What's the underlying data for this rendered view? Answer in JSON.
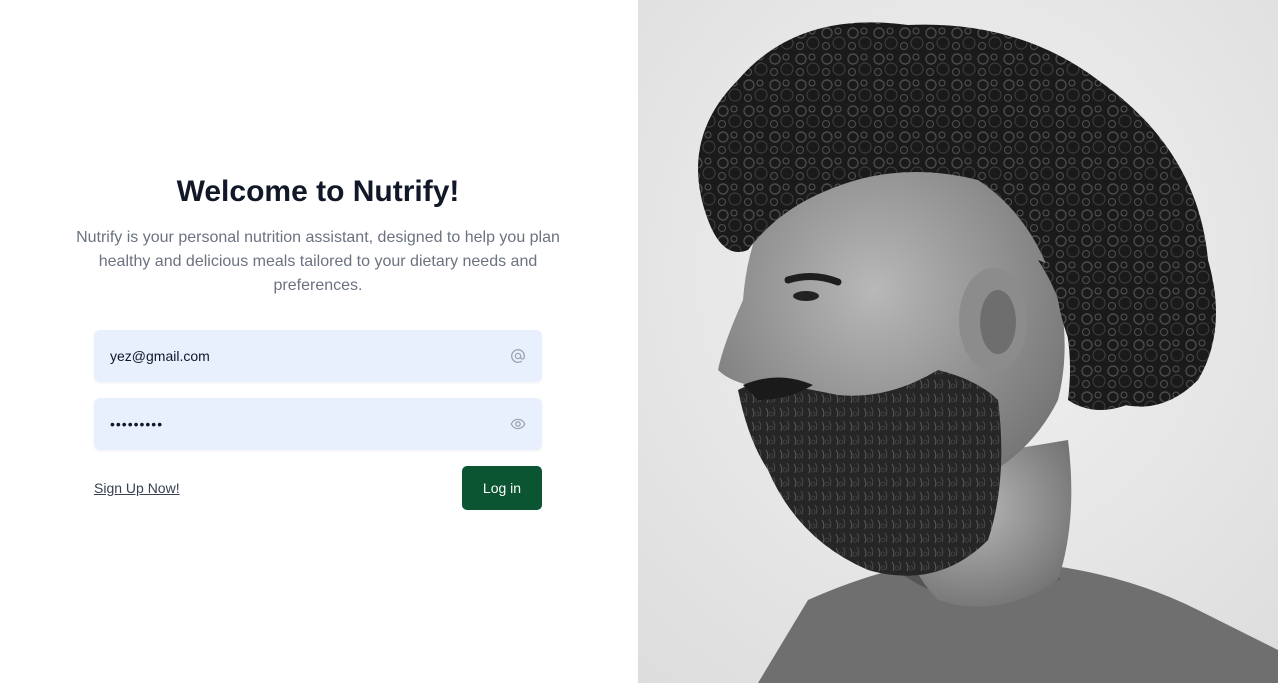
{
  "login": {
    "title": "Welcome to Nutrify!",
    "description": "Nutrify is your personal nutrition assistant, designed to help you plan healthy and delicious meals tailored to your dietary needs and preferences.",
    "email_value": "yez@gmail.com",
    "email_icon": "at-icon",
    "password_value": "•••••••••",
    "password_icon": "eye-icon",
    "signup_label": "Sign Up Now!",
    "login_label": "Log in"
  },
  "colors": {
    "primary_button": "#0b5533",
    "input_bg": "#e8f0fe",
    "title": "#111827",
    "description": "#6b7280"
  },
  "hero_image": {
    "subject": "black-and-white portrait of a bearded man with curly hair, profile view"
  }
}
